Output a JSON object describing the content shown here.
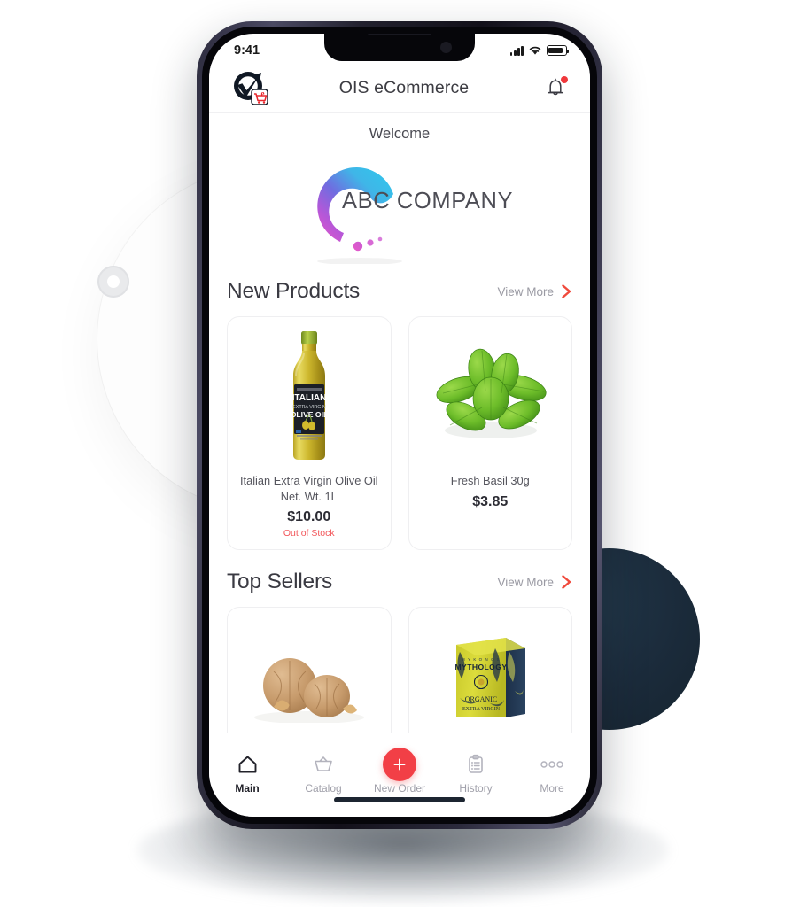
{
  "status_bar": {
    "time": "9:41",
    "signal_icon": "cellular-signal-icon",
    "wifi_icon": "wifi-icon",
    "battery_icon": "battery-icon"
  },
  "app_bar": {
    "logo_icon": "ois-ecommerce-logo-icon",
    "title": "OIS eCommerce",
    "notification_icon": "bell-icon",
    "notification_badge": true
  },
  "welcome": {
    "text": "Welcome"
  },
  "company": {
    "name": "ABC COMPANY",
    "logo_icon": "abc-company-swoosh-logo"
  },
  "sections": [
    {
      "title": "New Products",
      "view_more_label": "View More",
      "view_more_icon": "chevron-right-icon",
      "products": [
        {
          "name": "Italian Extra Virgin Olive Oil Net. Wt. 1L",
          "price": "$10.00",
          "stock_status": "Out of Stock",
          "image_icon": "olive-oil-bottle-image"
        },
        {
          "name": "Fresh Basil 30g",
          "price": "$3.85",
          "stock_status": "",
          "image_icon": "fresh-basil-image"
        }
      ]
    },
    {
      "title": "Top Sellers",
      "view_more_label": "View More",
      "view_more_icon": "chevron-right-icon",
      "products": [
        {
          "name": "",
          "price": "",
          "stock_status": "",
          "image_icon": "walnuts-image"
        },
        {
          "name": "",
          "price": "",
          "stock_status": "",
          "image_icon": "mythology-organic-extra-virgin-box-image"
        }
      ]
    }
  ],
  "tab_bar": {
    "items": [
      {
        "label": "Main",
        "icon": "home-icon",
        "active": true
      },
      {
        "label": "Catalog",
        "icon": "basket-icon",
        "active": false
      },
      {
        "label": "New Order",
        "icon": "plus-circle-icon",
        "active": false
      },
      {
        "label": "History",
        "icon": "clipboard-list-icon",
        "active": false
      },
      {
        "label": "More",
        "icon": "ellipsis-icon",
        "active": false
      }
    ]
  },
  "colors": {
    "accent_red": "#f23f46",
    "out_of_stock_red": "#f2565a",
    "dark_circle": "#1b2b3b",
    "muted_text": "#9a9aa3",
    "title_text": "#3a3a42"
  }
}
